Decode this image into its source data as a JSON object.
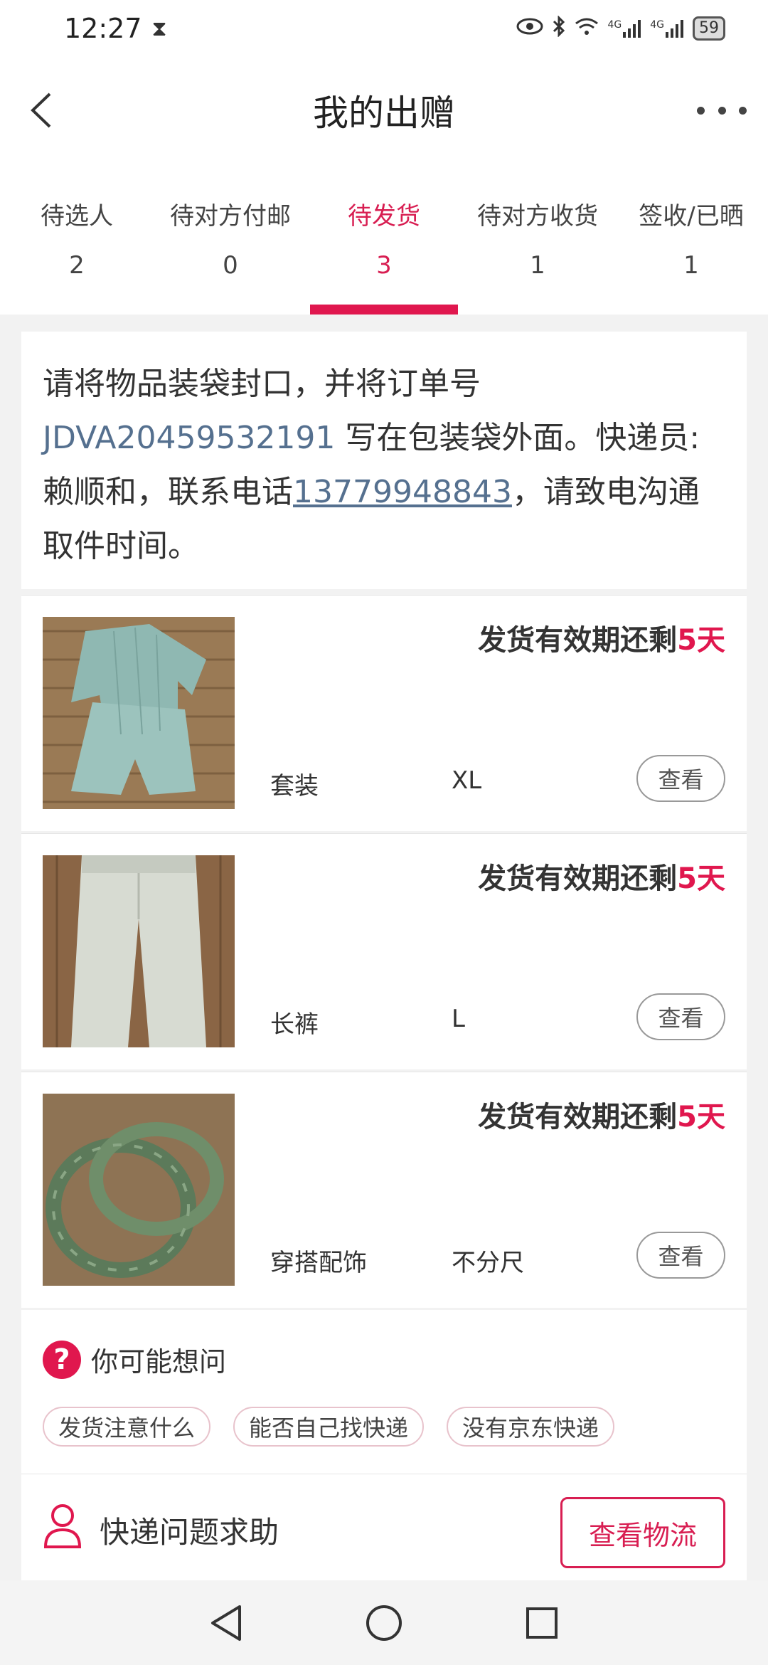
{
  "status_bar": {
    "time": "12:27",
    "battery": "59",
    "network_labels": [
      "4G",
      "4G"
    ]
  },
  "header": {
    "title": "我的出赠"
  },
  "tabs": [
    {
      "label": "待选人",
      "count": "2"
    },
    {
      "label": "待对方付邮",
      "count": "0"
    },
    {
      "label": "待发货",
      "count": "3",
      "active": true
    },
    {
      "label": "待对方收货",
      "count": "1"
    },
    {
      "label": "签收/已晒",
      "count": "1"
    }
  ],
  "notice": {
    "prefix": "请将物品装袋封口，并将订单号 ",
    "order_no": "JDVA20459532191",
    "mid": " 写在包装袋外面。快递员:赖顺和，联系电话",
    "phone": "13779948843",
    "suffix": "，请致电沟通取件时间。"
  },
  "items": [
    {
      "expire_prefix": "发货有效期还剩",
      "expire_days": "5天",
      "category": "套装",
      "size": "XL",
      "view_label": "查看",
      "thumb": "teal-pajama-set"
    },
    {
      "expire_prefix": "发货有效期还剩",
      "expire_days": "5天",
      "category": "长裤",
      "size": "L",
      "view_label": "查看",
      "thumb": "white-trousers"
    },
    {
      "expire_prefix": "发货有效期还剩",
      "expire_days": "5天",
      "category": "穿搭配饰",
      "size": "不分尺",
      "view_label": "查看",
      "thumb": "jade-bangles"
    }
  ],
  "faq": {
    "title": "你可能想问",
    "chips": [
      "发货注意什么",
      "能否自己找快递",
      "没有京东快递"
    ]
  },
  "help": {
    "label": "快递问题求助",
    "track_button": "查看物流"
  },
  "colors": {
    "accent": "#e0174e",
    "link": "#55708f"
  }
}
